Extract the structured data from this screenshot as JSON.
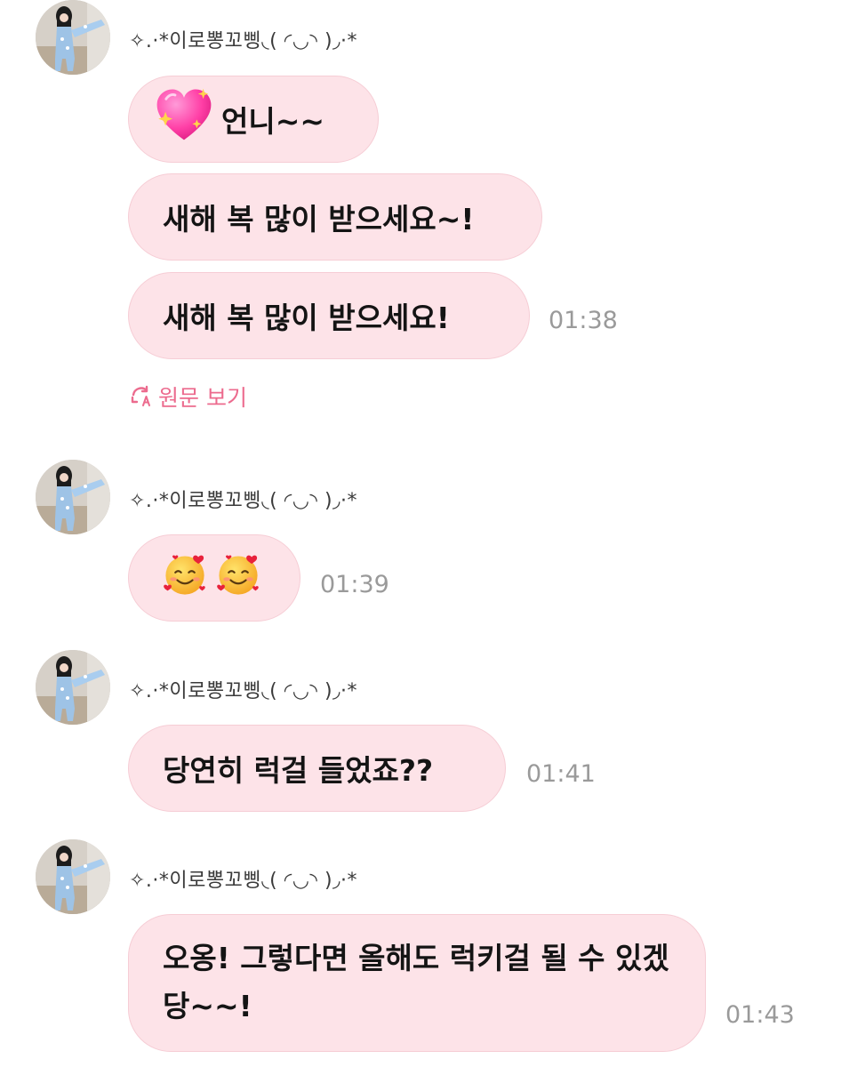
{
  "colors": {
    "bubble_bg": "#fde3e8",
    "bubble_border": "#f6cdd5",
    "timestamp": "#9a9a9a",
    "translate_link": "#ec6b8e"
  },
  "messages": [
    {
      "sender": "✧.·*이로뽕꼬삥◟( ◜◡◝ )◞·*",
      "bubbles": [
        {
          "emoji": "sparkling-heart",
          "text": "언니~~"
        },
        {
          "text": "새해 복 많이 받으세요~!"
        },
        {
          "text": "새해 복 많이 받으세요!",
          "time": "01:38"
        }
      ],
      "translate_link": {
        "icon": "translate-icon",
        "label": "원문 보기"
      }
    },
    {
      "sender": "✧.·*이로뽕꼬삥◟( ◜◡◝ )◞·*",
      "bubbles": [
        {
          "emoji": "smiling-face-with-hearts",
          "emoji_count": 2,
          "text": "",
          "time": "01:39"
        }
      ]
    },
    {
      "sender": "✧.·*이로뽕꼬삥◟( ◜◡◝ )◞·*",
      "bubbles": [
        {
          "text": "당연히 럭걸 들었죠??",
          "time": "01:41"
        }
      ]
    },
    {
      "sender": "✧.·*이로뽕꼬삥◟( ◜◡◝ )◞·*",
      "bubbles": [
        {
          "text": "오옹! 그렇다면 올해도 럭키걸 될 수 있겠당~~!",
          "time": "01:43"
        }
      ]
    }
  ]
}
